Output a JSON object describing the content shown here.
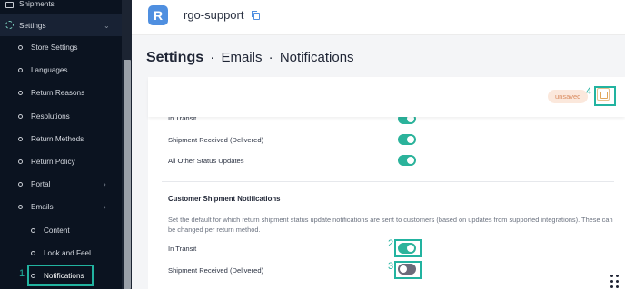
{
  "sidebar": {
    "items": [
      {
        "label": "Shipments"
      },
      {
        "label": "Settings"
      },
      {
        "label": "Store Settings"
      },
      {
        "label": "Languages"
      },
      {
        "label": "Return Reasons"
      },
      {
        "label": "Resolutions"
      },
      {
        "label": "Return Methods"
      },
      {
        "label": "Return Policy"
      },
      {
        "label": "Portal"
      },
      {
        "label": "Emails"
      },
      {
        "label": "Content"
      },
      {
        "label": "Look and Feel"
      },
      {
        "label": "Notifications"
      }
    ]
  },
  "header": {
    "logo_letter": "R",
    "shop_name": "rgo-support"
  },
  "breadcrumb": {
    "root": "Settings",
    "separator": "·",
    "level1": "Emails",
    "level2": "Notifications"
  },
  "card": {
    "status_badge": "unsaved"
  },
  "merchant_rows": [
    {
      "label": "In Transit",
      "enabled": true
    },
    {
      "label": "Shipment Received (Delivered)",
      "enabled": true
    },
    {
      "label": "All Other Status Updates",
      "enabled": true
    }
  ],
  "customer_section": {
    "title": "Customer Shipment Notifications",
    "description": "Set the default for which return shipment status update notifications are sent to customers (based on updates from supported integrations). These can be changed per return method.",
    "rows": [
      {
        "label": "In Transit",
        "enabled": true
      },
      {
        "label": "Shipment Received (Delivered)",
        "enabled": false
      }
    ]
  },
  "annotations": [
    "1",
    "2",
    "3",
    "4"
  ],
  "colors": {
    "accent": "#2bb39b",
    "highlight": "#22b3a0",
    "sidebar_bg": "#0b1320",
    "toggle_off": "#6b6b7a"
  }
}
